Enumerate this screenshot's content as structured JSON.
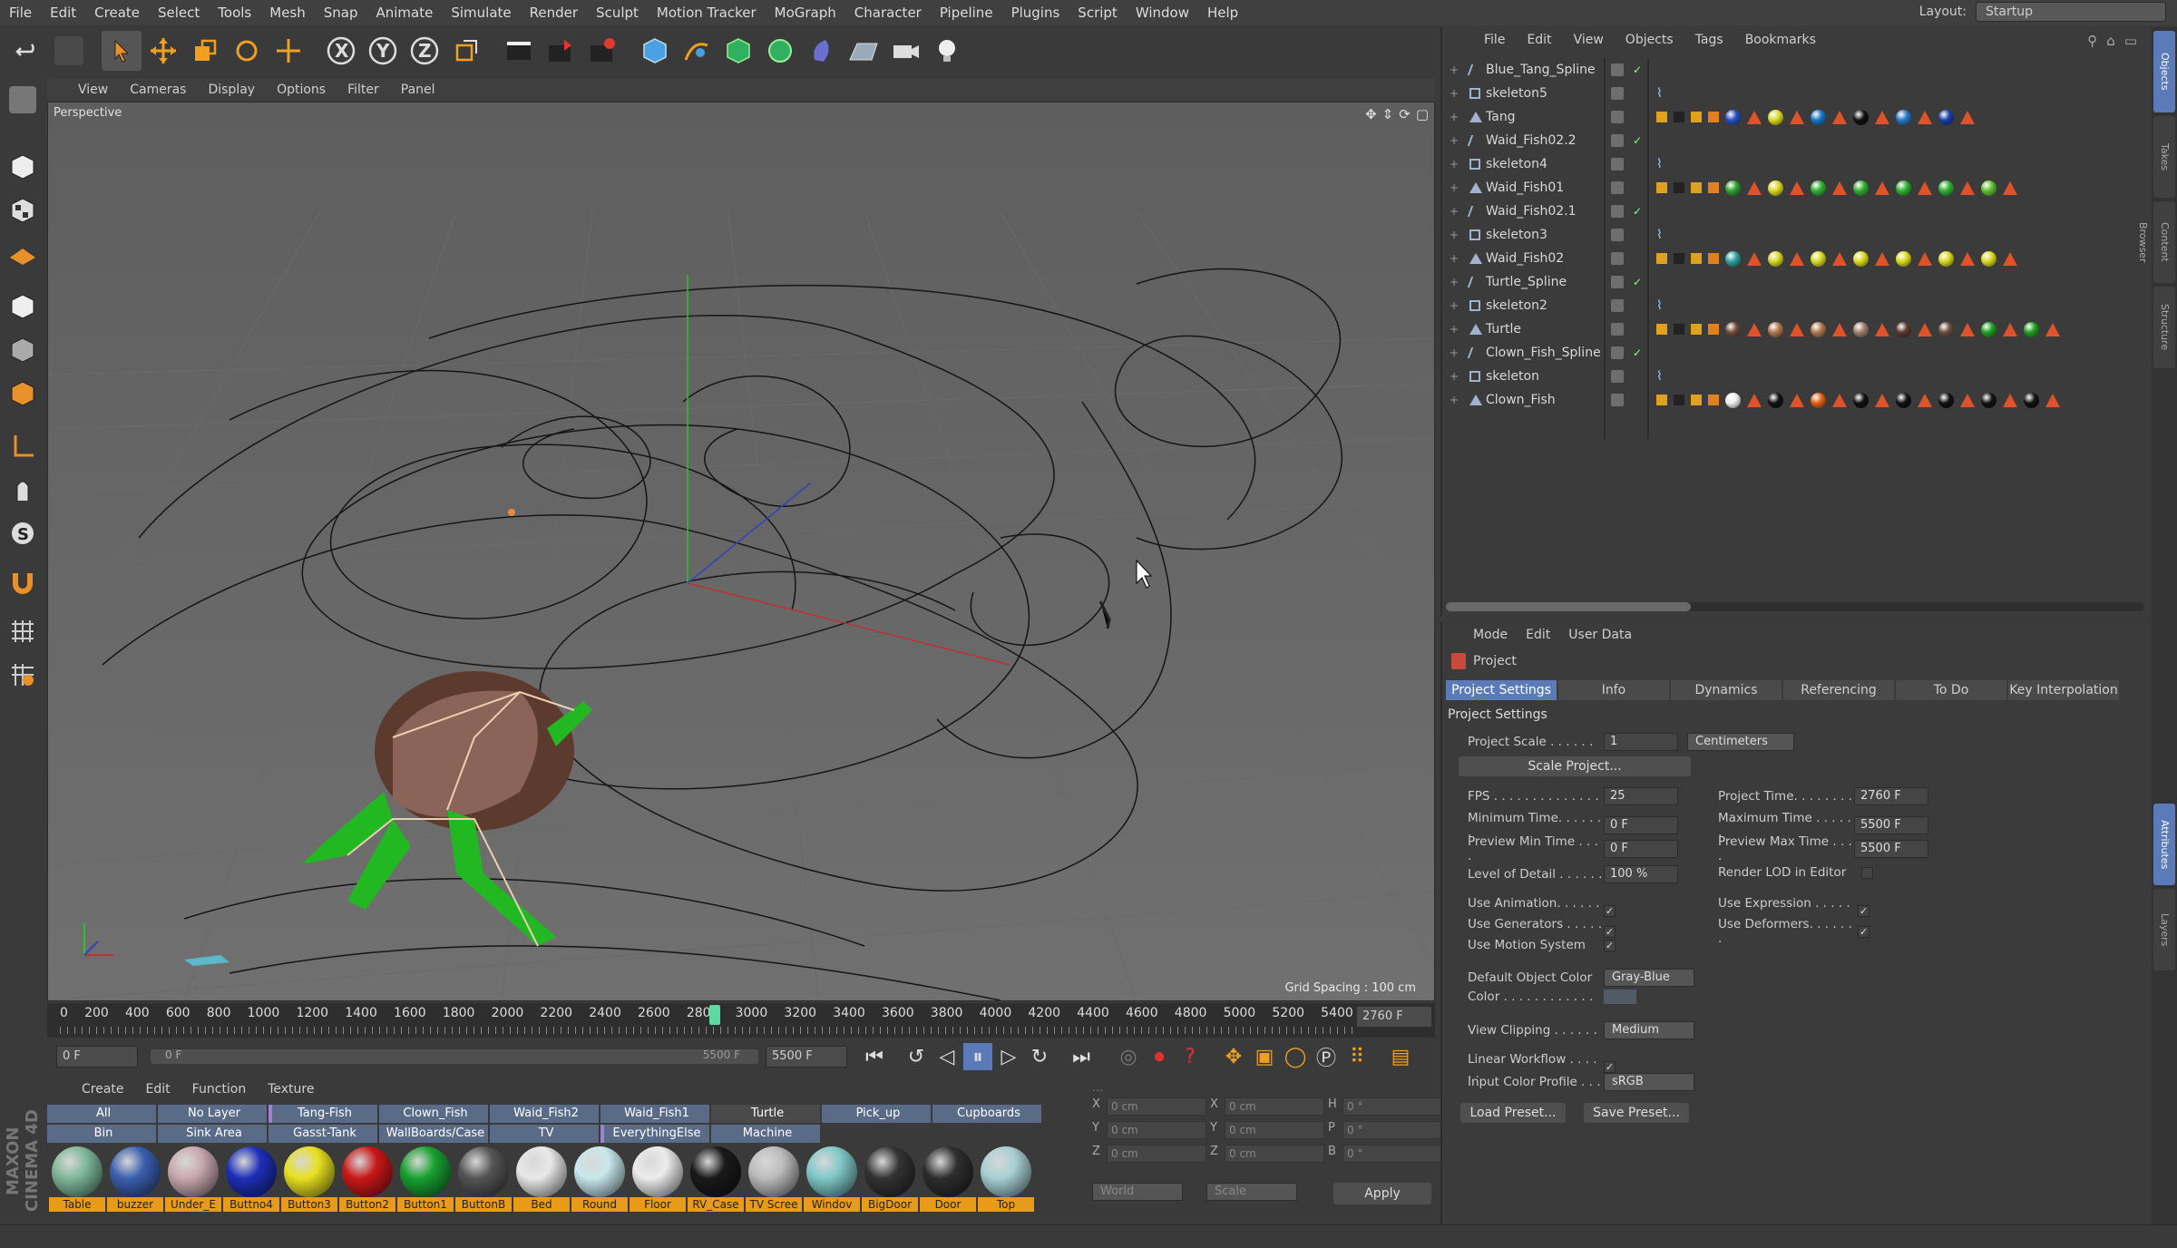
{
  "menubar": {
    "items": [
      "File",
      "Edit",
      "Create",
      "Select",
      "Tools",
      "Mesh",
      "Snap",
      "Animate",
      "Simulate",
      "Render",
      "Sculpt",
      "Motion Tracker",
      "MoGraph",
      "Character",
      "Pipeline",
      "Plugins",
      "Script",
      "Window",
      "Help"
    ],
    "layout_label": "Layout:",
    "layout_value": "Startup"
  },
  "toolbar": {
    "icons": [
      "undo-icon",
      "redo-icon",
      "select-arrow-icon",
      "move-icon",
      "scale-icon",
      "rotate-icon",
      "live-select-icon",
      "x-axis-icon",
      "y-axis-icon",
      "z-axis-icon",
      "world-coordinates-icon",
      "render-view-icon",
      "render-to-picture-viewer-icon",
      "render-settings-icon",
      "cube-icon",
      "pen-icon",
      "subdivision-icon",
      "array-icon",
      "deformer-icon",
      "floor-icon",
      "camera-icon",
      "light-icon"
    ]
  },
  "viewport": {
    "menu": [
      "View",
      "Cameras",
      "Display",
      "Options",
      "Filter",
      "Panel"
    ],
    "label": "Perspective",
    "grid_spacing": "Grid Spacing : 100 cm"
  },
  "timeline": {
    "ticks": [
      "0",
      "200",
      "400",
      "600",
      "800",
      "1000",
      "1200",
      "1400",
      "1600",
      "1800",
      "2000",
      "2200",
      "2400",
      "2600",
      "2800",
      "3000",
      "3200",
      "3400",
      "3600",
      "3800",
      "4000",
      "4200",
      "4400",
      "4600",
      "4800",
      "5000",
      "5200",
      "5400"
    ],
    "current_frame": "2760 F",
    "playhead_fraction": 0.502
  },
  "transport": {
    "start_field": "0 F",
    "preview_start": "0 F",
    "preview_end": "5500 F",
    "end_field": "5500 F"
  },
  "material_manager": {
    "menu": [
      "Create",
      "Edit",
      "Function",
      "Texture"
    ],
    "layers_row1": [
      {
        "label": "All",
        "color": "#5a6b88"
      },
      {
        "label": "No Layer",
        "color": "#5a6b88"
      },
      {
        "label": "Tang-Fish",
        "color": "#7a5aa0"
      },
      {
        "label": "Clown_Fish",
        "color": "#5a6b88"
      },
      {
        "label": "Waid_Fish2",
        "color": "#5a6b88"
      },
      {
        "label": "Waid_Fish1",
        "color": "#5a6b88"
      },
      {
        "label": "Turtle",
        "color": "#4a4a4a"
      },
      {
        "label": "Pick_up",
        "color": "#5a6b88"
      },
      {
        "label": "Cupboards",
        "color": "#5a6b88"
      }
    ],
    "layers_row2": [
      {
        "label": "Bin",
        "color": "#5a6b88"
      },
      {
        "label": "Sink Area",
        "color": "#5a6b88"
      },
      {
        "label": "Gasst-Tank",
        "color": "#5a6b88"
      },
      {
        "label": "WallBoards/Case",
        "color": "#5a6b88"
      },
      {
        "label": "TV",
        "color": "#5a6b88"
      },
      {
        "label": "EverythingElse",
        "color": "#7a5aa0"
      },
      {
        "label": "Machine",
        "color": "#5a6b88"
      }
    ],
    "materials": [
      {
        "name": "Table",
        "color": "#7fb89a"
      },
      {
        "name": "buzzer",
        "color": "#3b5fb0"
      },
      {
        "name": "Under_E",
        "color": "#c8a8b0"
      },
      {
        "name": "Buttno4",
        "color": "#1e2fb8"
      },
      {
        "name": "Button3",
        "color": "#e8e020"
      },
      {
        "name": "Button2",
        "color": "#c81818"
      },
      {
        "name": "Button1",
        "color": "#18a030"
      },
      {
        "name": "ButtonB",
        "color": "#555555"
      },
      {
        "name": "Bed",
        "color": "#e8e8e8"
      },
      {
        "name": "Round",
        "color": "#c8e8ec"
      },
      {
        "name": "Floor",
        "color": "#ececec"
      },
      {
        "name": "RV_Case",
        "color": "#1a1a1a"
      },
      {
        "name": "TV Scree",
        "color": "#bcbcbc"
      },
      {
        "name": "Windov",
        "color": "#80c8c8"
      },
      {
        "name": "BigDoor",
        "color": "#333333"
      },
      {
        "name": "Door",
        "color": "#2e2e2e"
      },
      {
        "name": "Top",
        "color": "#a8d0d4"
      }
    ]
  },
  "coords": {
    "rows": [
      {
        "a": "X",
        "v1": "0 cm",
        "b": "X",
        "v2": "0 cm",
        "c": "H",
        "v3": "0 °"
      },
      {
        "a": "Y",
        "v1": "0 cm",
        "b": "Y",
        "v2": "0 cm",
        "c": "P",
        "v3": "0 °"
      },
      {
        "a": "Z",
        "v1": "0 cm",
        "b": "Z",
        "v2": "0 cm",
        "c": "B",
        "v3": "0 °"
      }
    ],
    "world": "World",
    "scale": "Scale",
    "apply": "Apply"
  },
  "object_manager": {
    "menu": [
      "File",
      "Edit",
      "View",
      "Objects",
      "Tags",
      "Bookmarks"
    ],
    "objects": [
      {
        "name": "Blue_Tang_Spline",
        "type": "spline",
        "tags": []
      },
      {
        "name": "skeleton5",
        "type": "null",
        "tags": [
          "ik"
        ]
      },
      {
        "name": "Tang",
        "type": "joint",
        "tags": [
          "#2550c8",
          "#d8d820",
          "#1878c8",
          "#111111",
          "#2878c8",
          "#1840a8"
        ]
      },
      {
        "name": "Waid_Fish02.2",
        "type": "spline",
        "tags": []
      },
      {
        "name": "skeleton4",
        "type": "null",
        "tags": [
          "ik"
        ]
      },
      {
        "name": "Waid_Fish01",
        "type": "joint",
        "tags": [
          "#30a030",
          "#d8d820",
          "#30b030",
          "#30b030",
          "#30b030",
          "#30b030",
          "#60c030"
        ]
      },
      {
        "name": "Waid_Fish02.1",
        "type": "spline",
        "tags": []
      },
      {
        "name": "skeleton3",
        "type": "null",
        "tags": [
          "ik"
        ]
      },
      {
        "name": "Waid_Fish02",
        "type": "joint",
        "tags": [
          "#30a0a0",
          "#d8d820",
          "#d8d820",
          "#d8d820",
          "#d8d820",
          "#d8d820",
          "#d8d820"
        ]
      },
      {
        "name": "Turtle_Spline",
        "type": "spline",
        "tags": []
      },
      {
        "name": "skeleton2",
        "type": "null",
        "tags": [
          "ik"
        ]
      },
      {
        "name": "Turtle",
        "type": "joint",
        "tags": [
          "#6e4a3a",
          "#b07850",
          "#b07850",
          "#a08070",
          "#5a3a30",
          "#6a5040",
          "#20a020",
          "#20a020"
        ]
      },
      {
        "name": "Clown_Fish_Spline",
        "type": "spline",
        "tags": []
      },
      {
        "name": "skeleton",
        "type": "null",
        "tags": [
          "ik"
        ]
      },
      {
        "name": "Clown_Fish",
        "type": "joint",
        "tags": [
          "#eeeeee",
          "#111111",
          "#e06010",
          "#111111",
          "#111111",
          "#111111",
          "#111111",
          "#111111"
        ]
      }
    ]
  },
  "attributes": {
    "menu": [
      "Mode",
      "Edit",
      "User Data"
    ],
    "title": "Project",
    "tabs": [
      "Project Settings",
      "Info",
      "Dynamics",
      "Referencing",
      "To Do",
      "Key Interpolation"
    ],
    "section": "Project Settings",
    "project_scale_label": "Project Scale . . . . . .",
    "project_scale": "1",
    "units": "Centimeters",
    "scale_project": "Scale Project...",
    "fps_label": "FPS . . . . . . . . . . . . . .",
    "fps": "25",
    "project_time_label": "Project Time. . . . . . . .",
    "project_time": "2760 F",
    "min_time_label": "Minimum Time. . . . . . .",
    "min_time": "0 F",
    "max_time_label": "Maximum Time . . . . . .",
    "max_time": "5500 F",
    "prev_min_label": "Preview Min Time . . . .",
    "prev_min": "0 F",
    "prev_max_label": "Preview Max Time . . . .",
    "prev_max": "5500 F",
    "lod_label": "Level of Detail . . . . . .",
    "lod": "100 %",
    "render_lod_label": "Render LOD in Editor",
    "use_anim": "Use Animation. . . . . . .",
    "use_expr": "Use Expression . . . . . .",
    "use_gen": "Use Generators . . . . . .",
    "use_def": "Use Deformers. . . . . . .",
    "use_motion": "Use Motion System",
    "def_color_label": "Default Object Color",
    "def_color": "Gray-Blue",
    "color_label": "Color . . . . . . . . . . . .",
    "view_clip_label": "View Clipping . . . . . .",
    "view_clip": "Medium",
    "linear_wf": "Linear Workflow . . . . . .",
    "input_profile_label": "Input Color Profile . . .",
    "input_profile": "sRGB",
    "load_preset": "Load Preset...",
    "save_preset": "Save Preset..."
  },
  "side_tabs": [
    "Objects",
    "Takes",
    "Content Browser",
    "Structure",
    "Attributes",
    "Layers"
  ],
  "brand": "MAXON CINEMA 4D"
}
